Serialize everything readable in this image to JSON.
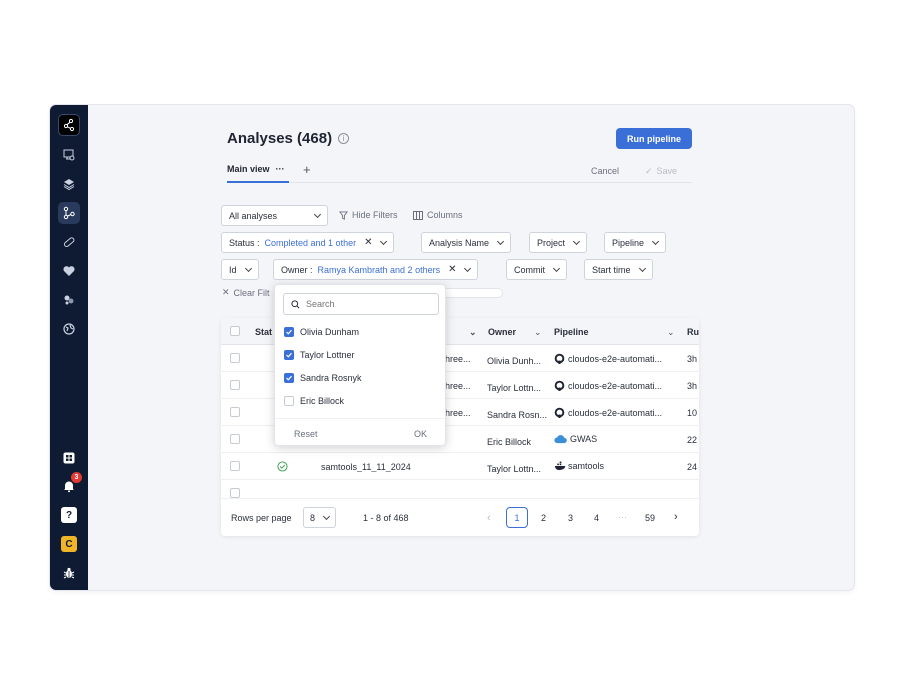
{
  "page": {
    "title": "Analyses (468)",
    "run_pipeline": "Run pipeline"
  },
  "tabs": {
    "main_view": "Main view",
    "more": "···",
    "add": "+",
    "cancel": "Cancel",
    "save": "Save"
  },
  "toolbar": {
    "view_select": "All analyses",
    "hide_filters": "Hide Filters",
    "columns": "Columns",
    "clear_filters": "Clear Filt"
  },
  "filters": {
    "status_label": "Status :",
    "status_value": "Completed and 1 other",
    "analysis_name": "Analysis Name",
    "project": "Project",
    "pipeline": "Pipeline",
    "id": "Id",
    "owner_label": "Owner :",
    "owner_value": "Ramya Kambrath and 2 others",
    "commit": "Commit",
    "start_time": "Start time"
  },
  "owner_dropdown": {
    "search_placeholder": "Search",
    "options": [
      {
        "label": "Olivia Dunham",
        "checked": true
      },
      {
        "label": "Taylor Lottner",
        "checked": true
      },
      {
        "label": "Sandra Rosnyk",
        "checked": true
      },
      {
        "label": "Eric Billock",
        "checked": false
      }
    ],
    "reset": "Reset",
    "ok": "OK"
  },
  "table": {
    "columns": [
      "Stat",
      "Owner",
      "Pipeline",
      "Ru"
    ],
    "rows": [
      {
        "name": "hree...",
        "owner": "Olivia Dunh...",
        "pipeline": "cloudos-e2e-automati...",
        "pipeline_icon": "github-icon",
        "run": "3h"
      },
      {
        "name": "hree...",
        "owner": "Taylor Lottn...",
        "pipeline": "cloudos-e2e-automati...",
        "pipeline_icon": "github-icon",
        "run": "3h"
      },
      {
        "name": "hree...",
        "owner": "Sandra Rosn...",
        "pipeline": "cloudos-e2e-automati...",
        "pipeline_icon": "github-icon",
        "run": "10"
      },
      {
        "name": "",
        "owner": "Eric Billock",
        "pipeline": "GWAS",
        "pipeline_icon": "cloud-icon",
        "run": "22"
      },
      {
        "name": "samtools_11_11_2024",
        "owner": "Taylor Lottn...",
        "pipeline": "samtools",
        "pipeline_icon": "docker-icon",
        "run": "24"
      }
    ]
  },
  "pagination": {
    "rows_per_page_label": "Rows per page",
    "rows_per_page": "8",
    "range": "1 - 8 of 468",
    "pages": [
      "1",
      "2",
      "3",
      "4",
      "···",
      "59"
    ],
    "current": "1"
  },
  "sidebar": {
    "notification_count": "3",
    "help": "?",
    "user_initial": "C"
  },
  "colors": {
    "primary": "#3b6fd8",
    "sidebar": "#0f1b33",
    "success": "#2e9e4c",
    "user_badge": "#f0b429"
  }
}
